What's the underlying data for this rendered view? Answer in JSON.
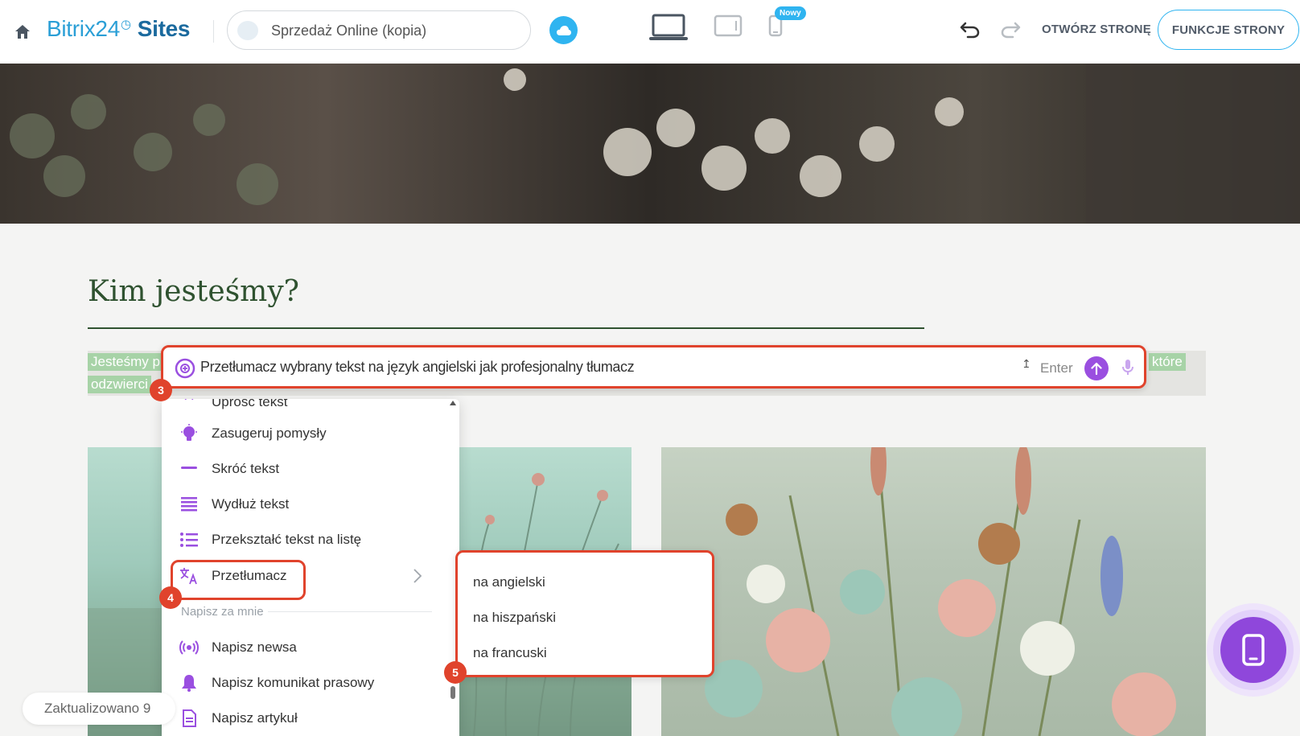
{
  "header": {
    "logo": "Bitrix24",
    "logo_suffix": "Sites",
    "site_name": "Sprzedaż Online (kopia)",
    "new_badge": "Nowy",
    "open_page": "OTWÓRZ STRONĘ",
    "page_functions": "FUNKCJE STRONY",
    "accent_color": "#2fb4f0"
  },
  "content": {
    "heading": "Kim jesteśmy?",
    "para_left_1": "Jesteśmy p",
    "para_left_2": "odzwierci",
    "para_right": "które"
  },
  "ai_prompt": {
    "text": "Przetłumacz wybrany tekst na język angielski jak profesjonalny tłumacz",
    "shortcut": "Enter",
    "accent_color": "#9a4fe0"
  },
  "steps": [
    "3",
    "4",
    "5"
  ],
  "ai_menu": {
    "items": [
      {
        "label": "Uprość tekst",
        "icon": "sparkle-icon"
      },
      {
        "label": "Zasugeruj pomysły",
        "icon": "lightbulb-icon"
      },
      {
        "label": "Skróć tekst",
        "icon": "shorten-icon"
      },
      {
        "label": "Wydłuż tekst",
        "icon": "lengthen-icon"
      },
      {
        "label": "Przekształć tekst na listę",
        "icon": "list-icon"
      },
      {
        "label": "Przetłumacz",
        "icon": "translate-icon"
      }
    ],
    "section": "Napisz za mnie",
    "write_items": [
      {
        "label": "Napisz newsa",
        "icon": "broadcast-icon"
      },
      {
        "label": "Napisz komunikat prasowy",
        "icon": "bell-icon"
      },
      {
        "label": "Napisz artykuł",
        "icon": "document-icon"
      }
    ]
  },
  "translate_submenu": [
    "na angielski",
    "na hiszpański",
    "na francuski"
  ],
  "status": {
    "updated": "Zaktualizowano 9"
  },
  "highlight_color": "#e0432c"
}
